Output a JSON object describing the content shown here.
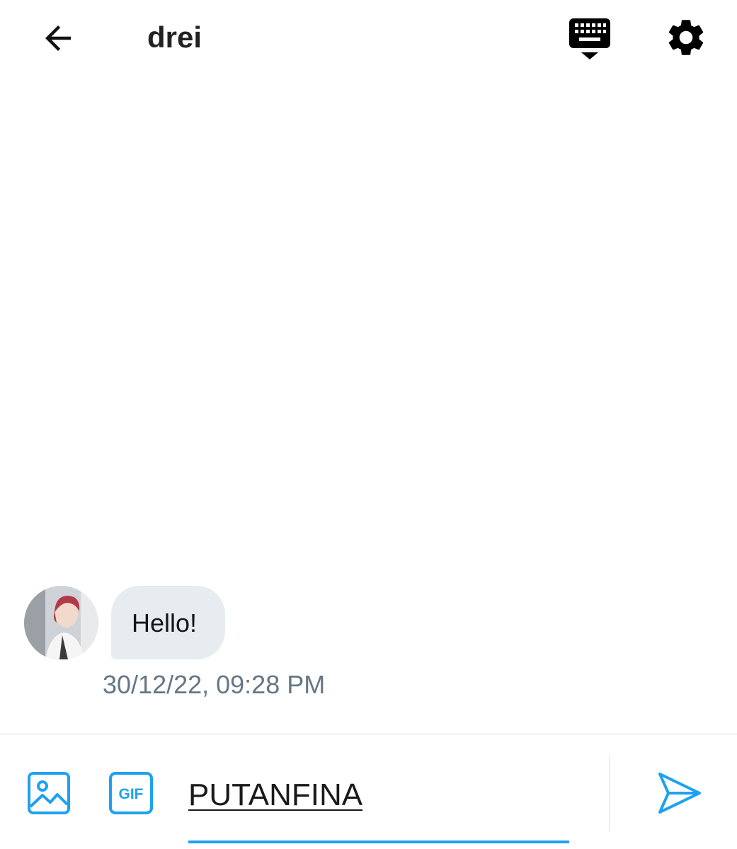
{
  "header": {
    "title": "drei",
    "icons": [
      "back-arrow-icon",
      "keyboard-icon",
      "gear-icon"
    ]
  },
  "conversation": {
    "messages": [
      {
        "text": "Hello!",
        "timestamp": "30/12/22, 09:28 PM"
      }
    ]
  },
  "composer": {
    "value": "PUTANFINA",
    "icons": [
      "image-icon",
      "gif-icon",
      "send-icon"
    ],
    "gif_label": "GIF"
  },
  "colors": {
    "accent": "#1da1f2",
    "bubble": "#e6ecf0",
    "timestamp": "#657786"
  }
}
